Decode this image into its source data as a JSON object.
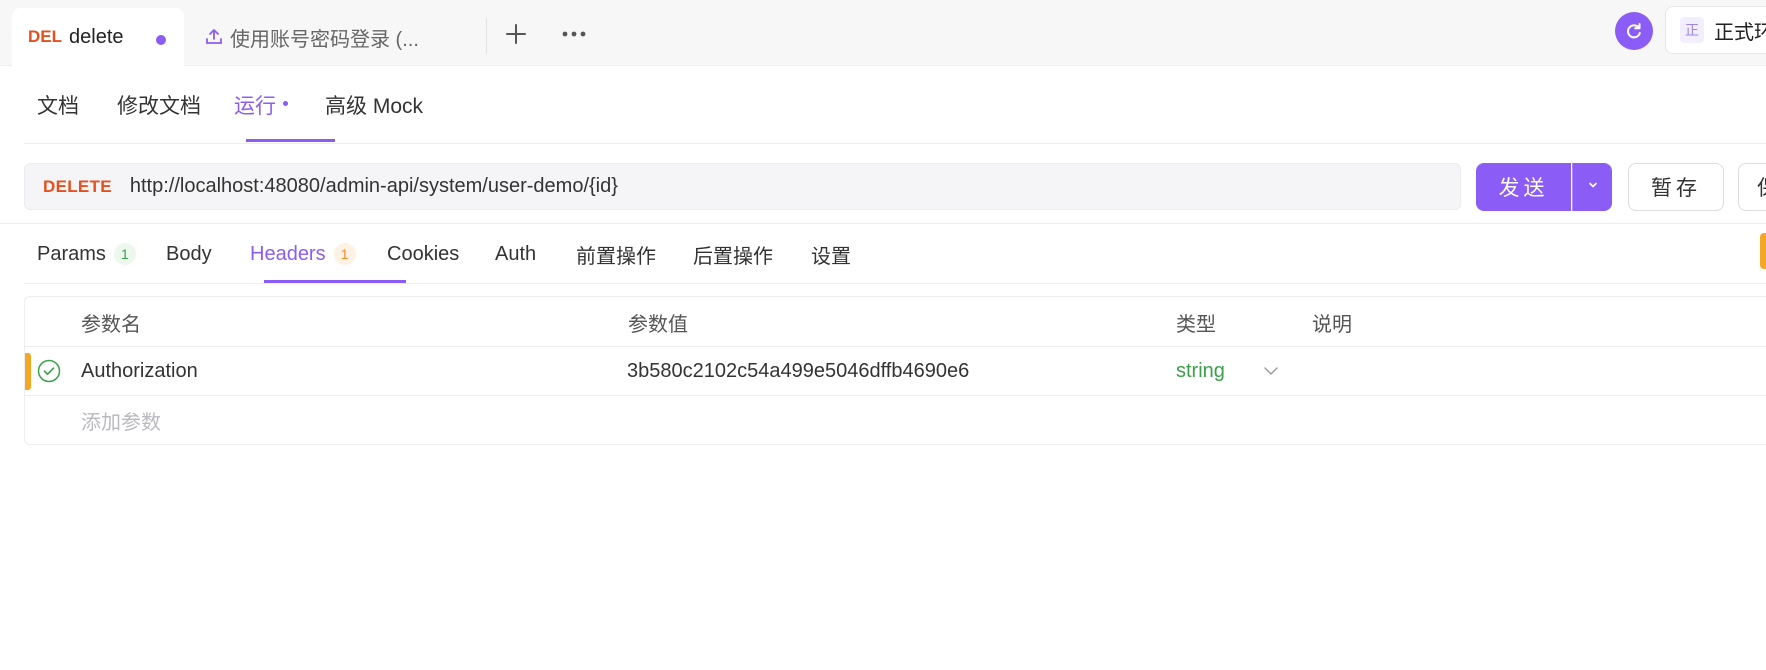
{
  "tabbar": {
    "active_tab": {
      "method": "DEL",
      "title": "delete"
    },
    "inactive_tab": {
      "title": "使用账号密码登录 (..."
    },
    "env_badge": "正",
    "env_name": "正式环境"
  },
  "subnav": {
    "items": [
      "文档",
      "修改文档",
      "运行",
      "高级 Mock"
    ],
    "active_index": 2
  },
  "request": {
    "method": "DELETE",
    "url": "http://localhost:48080/admin-api/system/user-demo/{id}",
    "send_label": "发送",
    "save_label": "暂存",
    "more_label": "保"
  },
  "req_tabs": {
    "params_label": "Params",
    "params_count": "1",
    "body_label": "Body",
    "headers_label": "Headers",
    "headers_count": "1",
    "cookies_label": "Cookies",
    "auth_label": "Auth",
    "pre_label": "前置操作",
    "post_label": "后置操作",
    "settings_label": "设置"
  },
  "headers_table": {
    "columns": {
      "name": "参数名",
      "value": "参数值",
      "type": "类型",
      "desc": "说明"
    },
    "rows": [
      {
        "name": "Authorization",
        "value": "3b580c2102c54a499e5046dffb4690e6",
        "type": "string",
        "desc": ""
      }
    ],
    "add_placeholder": "添加参数"
  },
  "colors": {
    "accent": "#8b5cf6",
    "method_delete": "#e5501e",
    "type_string": "#3aa04a",
    "marker": "#f5a623"
  },
  "icons": [
    "upload-icon",
    "plus-icon",
    "more-dots-icon",
    "sync-icon",
    "chevron-down-icon",
    "check-circle-icon"
  ]
}
